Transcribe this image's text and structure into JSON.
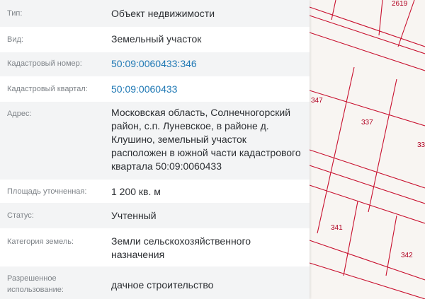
{
  "colors": {
    "link": "#1f78b4",
    "label_text": "#7e8388",
    "value_text": "#2c2f33",
    "row_shade": "#f3f4f5",
    "parcel_line": "#c8102e",
    "parcel_label": "#b00020"
  },
  "info": {
    "type": {
      "label": "Тип:",
      "value": "Объект недвижимости"
    },
    "kind": {
      "label": "Вид:",
      "value": "Земельный участок"
    },
    "cad_number": {
      "label": "Кадастровый номер:",
      "value": "50:09:0060433:346"
    },
    "cad_quarter": {
      "label": "Кадастровый квартал:",
      "value": "50:09:0060433"
    },
    "address": {
      "label": "Адрес:",
      "value": "Московская область, Солнечногорский район, с.п. Луневское, в районе д. Клушино, земельный участок расположен в южной части кадастрового квартала 50:09:0060433"
    },
    "area": {
      "label": "Площадь уточненная:",
      "value": "1 200 кв. м"
    },
    "status": {
      "label": "Статус:",
      "value": "Учтенный"
    },
    "land_category": {
      "label": "Категория земель:",
      "value": "Земли сельскохозяйственного назначения"
    },
    "permitted_use": {
      "label": "Разрешенное использование:",
      "value": "дачное строительство"
    }
  },
  "map": {
    "parcels": {
      "p2619": "2619",
      "p347": "347",
      "p337": "337",
      "p33": "33",
      "p341": "341",
      "p342": "342"
    }
  }
}
